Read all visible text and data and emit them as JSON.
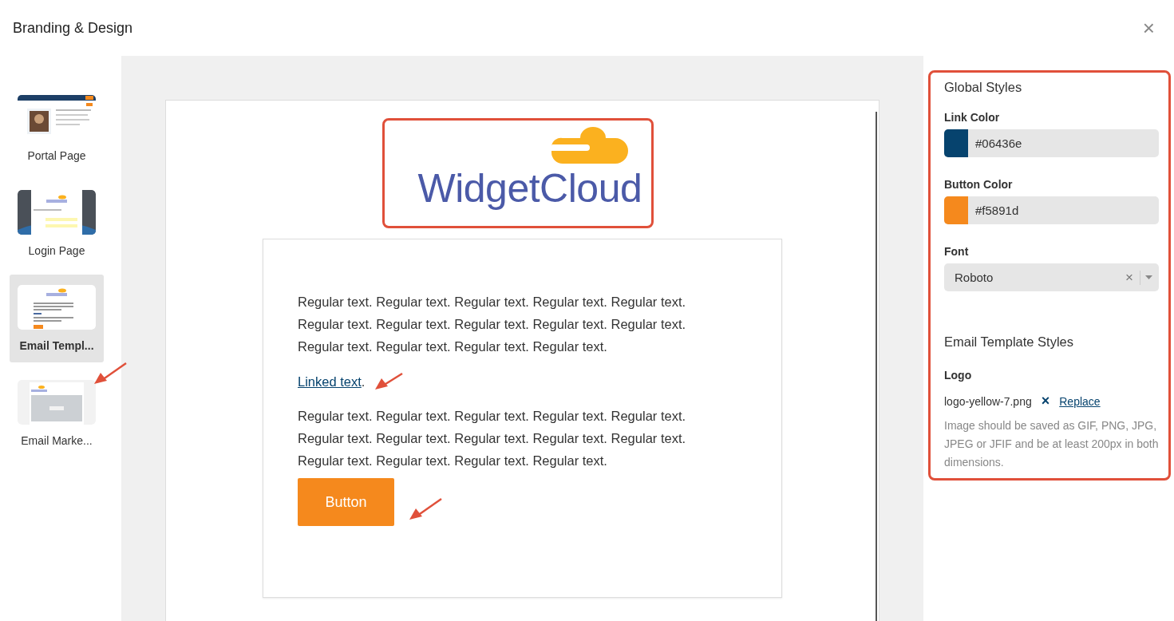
{
  "window": {
    "title": "Branding & Design",
    "close": "×"
  },
  "sidebar": {
    "items": [
      {
        "label": "Portal Page",
        "kind": "portal",
        "selected": false
      },
      {
        "label": "Login Page",
        "kind": "login",
        "selected": false
      },
      {
        "label": "Email Templ...",
        "kind": "email",
        "selected": true
      },
      {
        "label": "Email Marke...",
        "kind": "marketing",
        "selected": false
      }
    ]
  },
  "preview": {
    "logo": "WidgetCloud",
    "paragraphs": [
      "Regular text. Regular text. Regular text. Regular text. Regular text. Regular text. Regular text. Regular text. Regular text. Regular text. Regular text. Regular text. Regular text. Regular text.",
      "Regular text. Regular text. Regular text. Regular text. Regular text. Regular text. Regular text. Regular text. Regular text. Regular text. Regular text. Regular text. Regular text. Regular text."
    ],
    "link": {
      "text": "Linked text",
      "suffix": "."
    },
    "button": "Button"
  },
  "settings": {
    "global_title": "Global Styles",
    "colors": [
      {
        "label": "Link Color",
        "value": "#06436e",
        "color": "#06436e"
      },
      {
        "label": "Button Color",
        "value": "#f5891d",
        "color": "#f5891d"
      }
    ],
    "font": {
      "label": "Font",
      "value": "Roboto",
      "clear": "×"
    },
    "email_title": "Email Template Styles",
    "logo": {
      "label": "Logo",
      "file": "logo-yellow-7.png",
      "remove": "×",
      "replace": "Replace",
      "help": "Image should be saved as GIF, PNG, JPG, JPEG or JFIF and be at least 200px in both dimensions."
    }
  }
}
